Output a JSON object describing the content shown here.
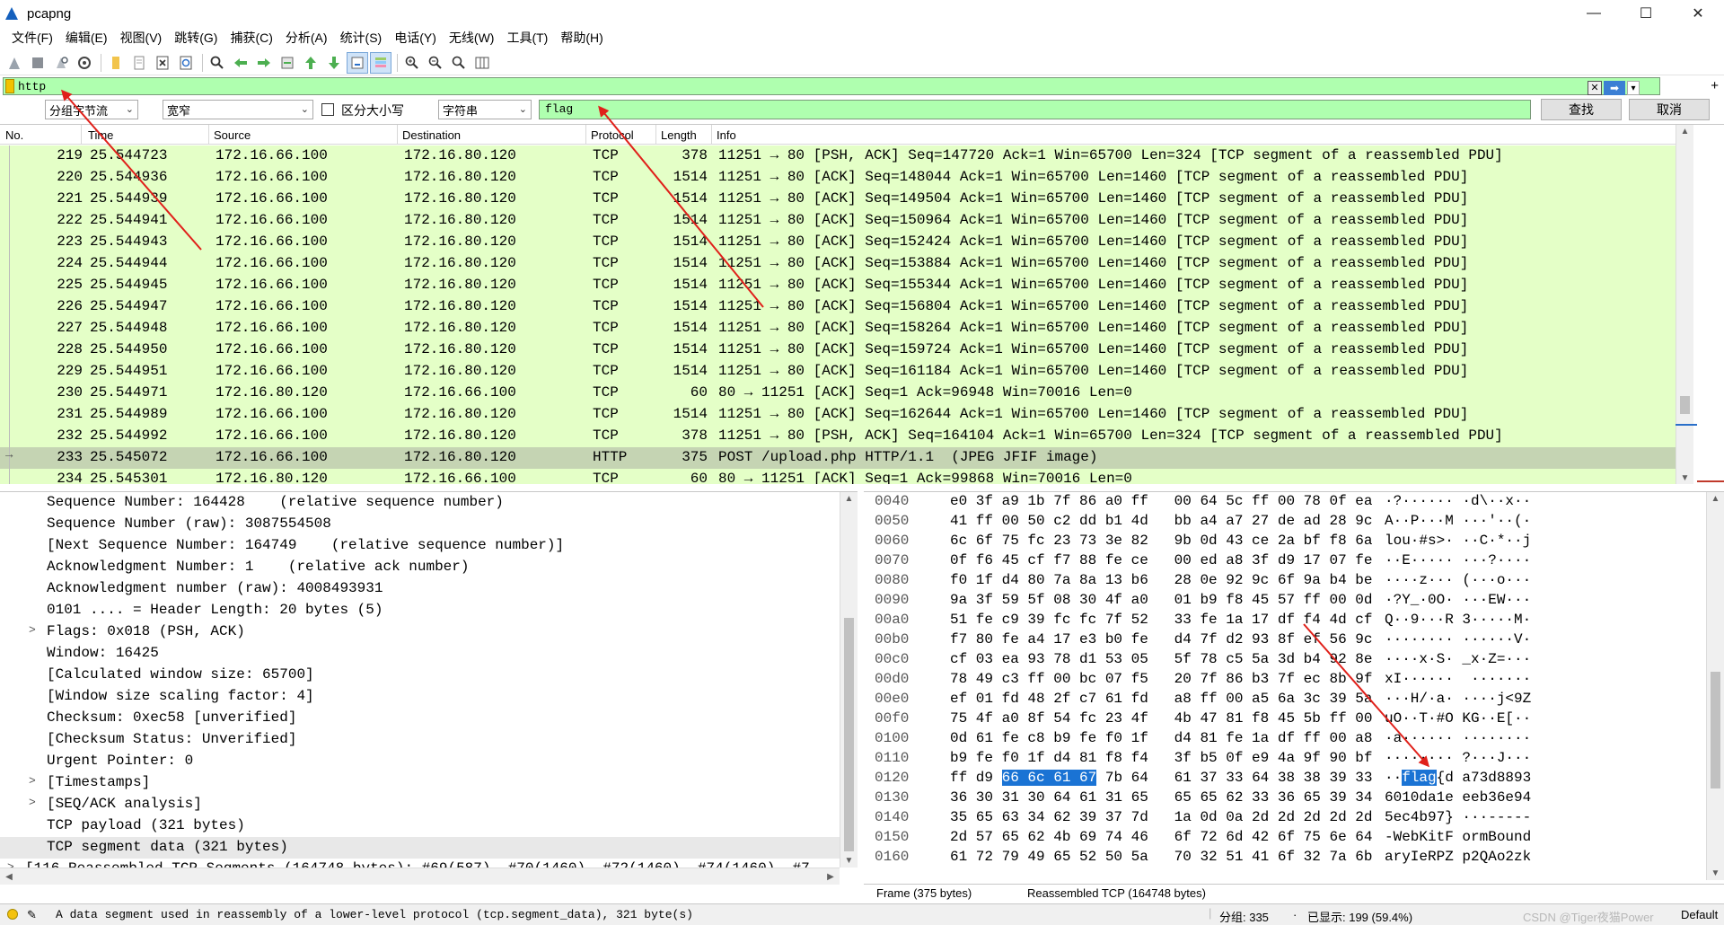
{
  "window": {
    "title": "pcapng",
    "controls": [
      "—",
      "☐",
      "✕"
    ]
  },
  "menu": [
    "文件(F)",
    "编辑(E)",
    "视图(V)",
    "跳转(G)",
    "捕获(C)",
    "分析(A)",
    "统计(S)",
    "电话(Y)",
    "无线(W)",
    "工具(T)",
    "帮助(H)"
  ],
  "toolbar_icons": [
    "shark-fin-start-icon",
    "stop-icon",
    "restart-icon",
    "options-gear-icon",
    "open-folder-icon",
    "file-icon",
    "close-file-icon",
    "reload-icon",
    "search-icon",
    "back-arrow-icon",
    "forward-arrow-icon",
    "goto-packet-icon",
    "first-packet-icon",
    "last-packet-icon",
    "autoscroll-icon",
    "colorize-icon",
    "zoom-in-icon",
    "zoom-out-icon",
    "zoom-reset-icon",
    "resize-columns-icon"
  ],
  "display_filter": {
    "value": "http",
    "clear": "✕",
    "apply": "➡",
    "dropdown": "▾",
    "add": "+"
  },
  "find": {
    "scope": "分组字节流",
    "charset": "宽窄",
    "case_label": "区分大小写",
    "type": "字符串",
    "query": "flag",
    "find_button": "查找",
    "cancel_button": "取消"
  },
  "packet_list": {
    "columns": [
      "No.",
      "Time",
      "Source",
      "Destination",
      "Protocol",
      "Length",
      "Info"
    ],
    "rows": [
      {
        "no": "219",
        "time": "25.544723",
        "src": "172.16.66.100",
        "dst": "172.16.80.120",
        "proto": "TCP",
        "len": "378",
        "info": "11251 → 80 [PSH, ACK] Seq=147720 Ack=1 Win=65700 Len=324 [TCP segment of a reassembled PDU]"
      },
      {
        "no": "220",
        "time": "25.544936",
        "src": "172.16.66.100",
        "dst": "172.16.80.120",
        "proto": "TCP",
        "len": "1514",
        "info": "11251 → 80 [ACK] Seq=148044 Ack=1 Win=65700 Len=1460 [TCP segment of a reassembled PDU]"
      },
      {
        "no": "221",
        "time": "25.544939",
        "src": "172.16.66.100",
        "dst": "172.16.80.120",
        "proto": "TCP",
        "len": "1514",
        "info": "11251 → 80 [ACK] Seq=149504 Ack=1 Win=65700 Len=1460 [TCP segment of a reassembled PDU]"
      },
      {
        "no": "222",
        "time": "25.544941",
        "src": "172.16.66.100",
        "dst": "172.16.80.120",
        "proto": "TCP",
        "len": "1514",
        "info": "11251 → 80 [ACK] Seq=150964 Ack=1 Win=65700 Len=1460 [TCP segment of a reassembled PDU]"
      },
      {
        "no": "223",
        "time": "25.544943",
        "src": "172.16.66.100",
        "dst": "172.16.80.120",
        "proto": "TCP",
        "len": "1514",
        "info": "11251 → 80 [ACK] Seq=152424 Ack=1 Win=65700 Len=1460 [TCP segment of a reassembled PDU]"
      },
      {
        "no": "224",
        "time": "25.544944",
        "src": "172.16.66.100",
        "dst": "172.16.80.120",
        "proto": "TCP",
        "len": "1514",
        "info": "11251 → 80 [ACK] Seq=153884 Ack=1 Win=65700 Len=1460 [TCP segment of a reassembled PDU]"
      },
      {
        "no": "225",
        "time": "25.544945",
        "src": "172.16.66.100",
        "dst": "172.16.80.120",
        "proto": "TCP",
        "len": "1514",
        "info": "11251 → 80 [ACK] Seq=155344 Ack=1 Win=65700 Len=1460 [TCP segment of a reassembled PDU]"
      },
      {
        "no": "226",
        "time": "25.544947",
        "src": "172.16.66.100",
        "dst": "172.16.80.120",
        "proto": "TCP",
        "len": "1514",
        "info": "11251 → 80 [ACK] Seq=156804 Ack=1 Win=65700 Len=1460 [TCP segment of a reassembled PDU]"
      },
      {
        "no": "227",
        "time": "25.544948",
        "src": "172.16.66.100",
        "dst": "172.16.80.120",
        "proto": "TCP",
        "len": "1514",
        "info": "11251 → 80 [ACK] Seq=158264 Ack=1 Win=65700 Len=1460 [TCP segment of a reassembled PDU]"
      },
      {
        "no": "228",
        "time": "25.544950",
        "src": "172.16.66.100",
        "dst": "172.16.80.120",
        "proto": "TCP",
        "len": "1514",
        "info": "11251 → 80 [ACK] Seq=159724 Ack=1 Win=65700 Len=1460 [TCP segment of a reassembled PDU]"
      },
      {
        "no": "229",
        "time": "25.544951",
        "src": "172.16.66.100",
        "dst": "172.16.80.120",
        "proto": "TCP",
        "len": "1514",
        "info": "11251 → 80 [ACK] Seq=161184 Ack=1 Win=65700 Len=1460 [TCP segment of a reassembled PDU]"
      },
      {
        "no": "230",
        "time": "25.544971",
        "src": "172.16.80.120",
        "dst": "172.16.66.100",
        "proto": "TCP",
        "len": "60",
        "info": "80 → 11251 [ACK] Seq=1 Ack=96948 Win=70016 Len=0"
      },
      {
        "no": "231",
        "time": "25.544989",
        "src": "172.16.66.100",
        "dst": "172.16.80.120",
        "proto": "TCP",
        "len": "1514",
        "info": "11251 → 80 [ACK] Seq=162644 Ack=1 Win=65700 Len=1460 [TCP segment of a reassembled PDU]"
      },
      {
        "no": "232",
        "time": "25.544992",
        "src": "172.16.66.100",
        "dst": "172.16.80.120",
        "proto": "TCP",
        "len": "378",
        "info": "11251 → 80 [PSH, ACK] Seq=164104 Ack=1 Win=65700 Len=324 [TCP segment of a reassembled PDU]"
      },
      {
        "no": "233",
        "time": "25.545072",
        "src": "172.16.66.100",
        "dst": "172.16.80.120",
        "proto": "HTTP",
        "len": "375",
        "info": "POST /upload.php HTTP/1.1  (JPEG JFIF image)"
      },
      {
        "no": "234",
        "time": "25.545301",
        "src": "172.16.80.120",
        "dst": "172.16.66.100",
        "proto": "TCP",
        "len": "60",
        "info": "80 → 11251 [ACK] Seq=1 Ack=99868 Win=70016 Len=0"
      }
    ]
  },
  "details": [
    {
      "text": "Sequence Number: 164428    (relative sequence number)",
      "expander": ""
    },
    {
      "text": "Sequence Number (raw): 3087554508",
      "expander": ""
    },
    {
      "text": "[Next Sequence Number: 164749    (relative sequence number)]",
      "expander": ""
    },
    {
      "text": "Acknowledgment Number: 1    (relative ack number)",
      "expander": ""
    },
    {
      "text": "Acknowledgment number (raw): 4008493931",
      "expander": ""
    },
    {
      "text": "0101 .... = Header Length: 20 bytes (5)",
      "expander": ""
    },
    {
      "text": "Flags: 0x018 (PSH, ACK)",
      "expander": ">"
    },
    {
      "text": "Window: 16425",
      "expander": ""
    },
    {
      "text": "[Calculated window size: 65700]",
      "expander": ""
    },
    {
      "text": "[Window size scaling factor: 4]",
      "expander": ""
    },
    {
      "text": "Checksum: 0xec58 [unverified]",
      "expander": ""
    },
    {
      "text": "[Checksum Status: Unverified]",
      "expander": ""
    },
    {
      "text": "Urgent Pointer: 0",
      "expander": ""
    },
    {
      "text": "[Timestamps]",
      "expander": ">"
    },
    {
      "text": "[SEQ/ACK analysis]",
      "expander": ">"
    },
    {
      "text": "TCP payload (321 bytes)",
      "expander": ""
    },
    {
      "text": "TCP segment data (321 bytes)",
      "expander": ""
    },
    {
      "text": "[116 Reassembled TCP Segments (164748 bytes): #69(587), #70(1460), #72(1460), #74(1460), #7",
      "expander": ">"
    }
  ],
  "bytes": [
    {
      "off": "0040",
      "hex": "e0 3f a9 1b 7f 86 a0 ff   00 64 5c ff 00 78 0f ea",
      "ascii": "·?······ ·d\\··x··"
    },
    {
      "off": "0050",
      "hex": "41 ff 00 50 c2 dd b1 4d   bb a4 a7 27 de ad 28 9c",
      "ascii": "A··P···M ···'··(·"
    },
    {
      "off": "0060",
      "hex": "6c 6f 75 fc 23 73 3e 82   9b 0d 43 ce 2a bf f8 6a",
      "ascii": "lou·#s>· ··C·*··j"
    },
    {
      "off": "0070",
      "hex": "0f f6 45 cf f7 88 fe ce   00 ed a8 3f d9 17 07 fe",
      "ascii": "··E····· ···?····"
    },
    {
      "off": "0080",
      "hex": "f0 1f d4 80 7a 8a 13 b6   28 0e 92 9c 6f 9a b4 be",
      "ascii": "····z··· (···o···"
    },
    {
      "off": "0090",
      "hex": "9a 3f 59 5f 08 30 4f a0   01 b9 f8 45 57 ff 00 0d",
      "ascii": "·?Y_·0O· ···EW···"
    },
    {
      "off": "00a0",
      "hex": "51 fe c9 39 fc fc 7f 52   33 fe 1a 17 df f4 4d cf",
      "ascii": "Q··9···R 3·····M·"
    },
    {
      "off": "00b0",
      "hex": "f7 80 fe a4 17 e3 b0 fe   d4 7f d2 93 8f ef 56 9c",
      "ascii": "········ ······V·"
    },
    {
      "off": "00c0",
      "hex": "cf 03 ea 93 78 d1 53 05   5f 78 c5 5a 3d b4 92 8e",
      "ascii": "····x·S· _x·Z=···"
    },
    {
      "off": "00d0",
      "hex": "78 49 c3 ff 00 bc 07 f5   20 7f 86 b3 7f ec 8b 9f",
      "ascii": "xI······  ·······"
    },
    {
      "off": "00e0",
      "hex": "ef 01 fd 48 2f c7 61 fd   a8 ff 00 a5 6a 3c 39 5a",
      "ascii": "···H/·a· ····j<9Z"
    },
    {
      "off": "00f0",
      "hex": "75 4f a0 8f 54 fc 23 4f   4b 47 81 f8 45 5b ff 00",
      "ascii": "uO··T·#O KG··E[··"
    },
    {
      "off": "0100",
      "hex": "0d 61 fe c8 b9 fe f0 1f   d4 81 fe 1a df ff 00 a8",
      "ascii": "·a······ ········"
    },
    {
      "off": "0110",
      "hex": "b9 fe f0 1f d4 81 f8 f4   3f b5 0f e9 4a 9f 90 bf",
      "ascii": "········ ?···J···"
    },
    {
      "off": "0120",
      "hex_pre": "ff d9 ",
      "hex_hl": "66 6c 61 67",
      "hex_post": " 7b 64   61 37 33 64 38 38 39 33",
      "ascii_pre": "··",
      "ascii_hl": "flag",
      "ascii_post": "{d a73d8893"
    },
    {
      "off": "0130",
      "hex": "36 30 31 30 64 61 31 65   65 65 62 33 36 65 39 34",
      "ascii": "6010da1e eeb36e94"
    },
    {
      "off": "0140",
      "hex": "35 65 63 34 62 39 37 7d   1a 0d 0a 2d 2d 2d 2d 2d",
      "ascii": "5ec4b97} ···-----"
    },
    {
      "off": "0150",
      "hex": "2d 57 65 62 4b 69 74 46   6f 72 6d 42 6f 75 6e 64",
      "ascii": "-WebKitF ormBound"
    },
    {
      "off": "0160",
      "hex": "61 72 79 49 65 52 50 5a   70 32 51 41 6f 32 7a 6b",
      "ascii": "aryIeRPZ p2QAo2zk"
    }
  ],
  "byte_tabs": [
    "Frame (375 bytes)",
    "Reassembled TCP (164748 bytes)"
  ],
  "status": {
    "message": "A data segment used in reassembly of a lower-level protocol (tcp.segment_data), 321 byte(s)",
    "packets": "分组: 335",
    "displayed": "已显示: 199 (59.4%)",
    "profile": "Default",
    "watermark": "CSDN @Tiger夜猫Power"
  },
  "colors": {
    "tcp_row": "#e4ffc7",
    "selected_row": "#c5d4b3",
    "filter_bg": "#afffaf",
    "highlight": "#1a73d4",
    "annotation": "#e0201a"
  }
}
